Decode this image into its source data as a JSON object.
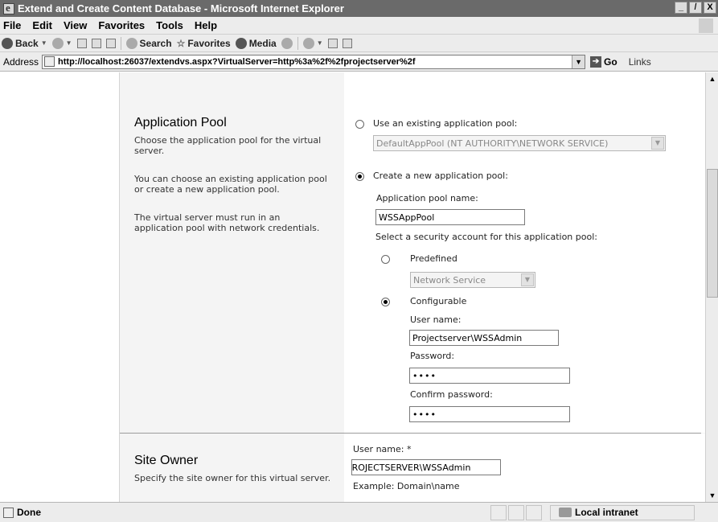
{
  "window": {
    "title": "Extend and Create Content Database - Microsoft Internet Explorer",
    "buttons": [
      "_",
      "̸",
      "X"
    ]
  },
  "menu": {
    "items": [
      "File",
      "Edit",
      "View",
      "Favorites",
      "Tools",
      "Help"
    ]
  },
  "toolbar": {
    "back": "Back",
    "search": "Search",
    "favorites": "Favorites",
    "media": "Media"
  },
  "address": {
    "label": "Address",
    "url": "http://localhost:26037/extendvs.aspx?VirtualServer=http%3a%2f%2fprojectserver%2f",
    "go": "Go",
    "links": "Links"
  },
  "app_pool": {
    "title": "Application Pool",
    "desc1": "Choose the application pool for the virtual server.",
    "desc2": "You can choose an existing application pool or create a new application pool.",
    "desc3": "The virtual server must run in an application pool with network credentials.",
    "use_existing_label": "Use an existing application pool:",
    "existing_selected": "DefaultAppPool (NT AUTHORITY\\NETWORK SERVICE)",
    "create_new_label": "Create a new application pool:",
    "pool_name_label": "Application pool name:",
    "pool_name_value": "WSSAppPool",
    "security_label": "Select a security account for this application pool:",
    "predefined_label": "Predefined",
    "predefined_selected": "Network Service",
    "configurable_label": "Configurable",
    "user_name_label": "User name:",
    "user_name_value": "Projectserver\\WSSAdmin",
    "password_label": "Password:",
    "password_value": "••••",
    "confirm_label": "Confirm password:",
    "confirm_value": "••••"
  },
  "site_owner": {
    "title": "Site Owner",
    "desc": "Specify the site owner for this virtual server.",
    "user_name_label": "User name: *",
    "user_name_value": "PROJECTSERVER\\WSSAdmin",
    "example": "Example: Domain\\name"
  },
  "status": {
    "text": "Done",
    "zone": "Local intranet"
  }
}
